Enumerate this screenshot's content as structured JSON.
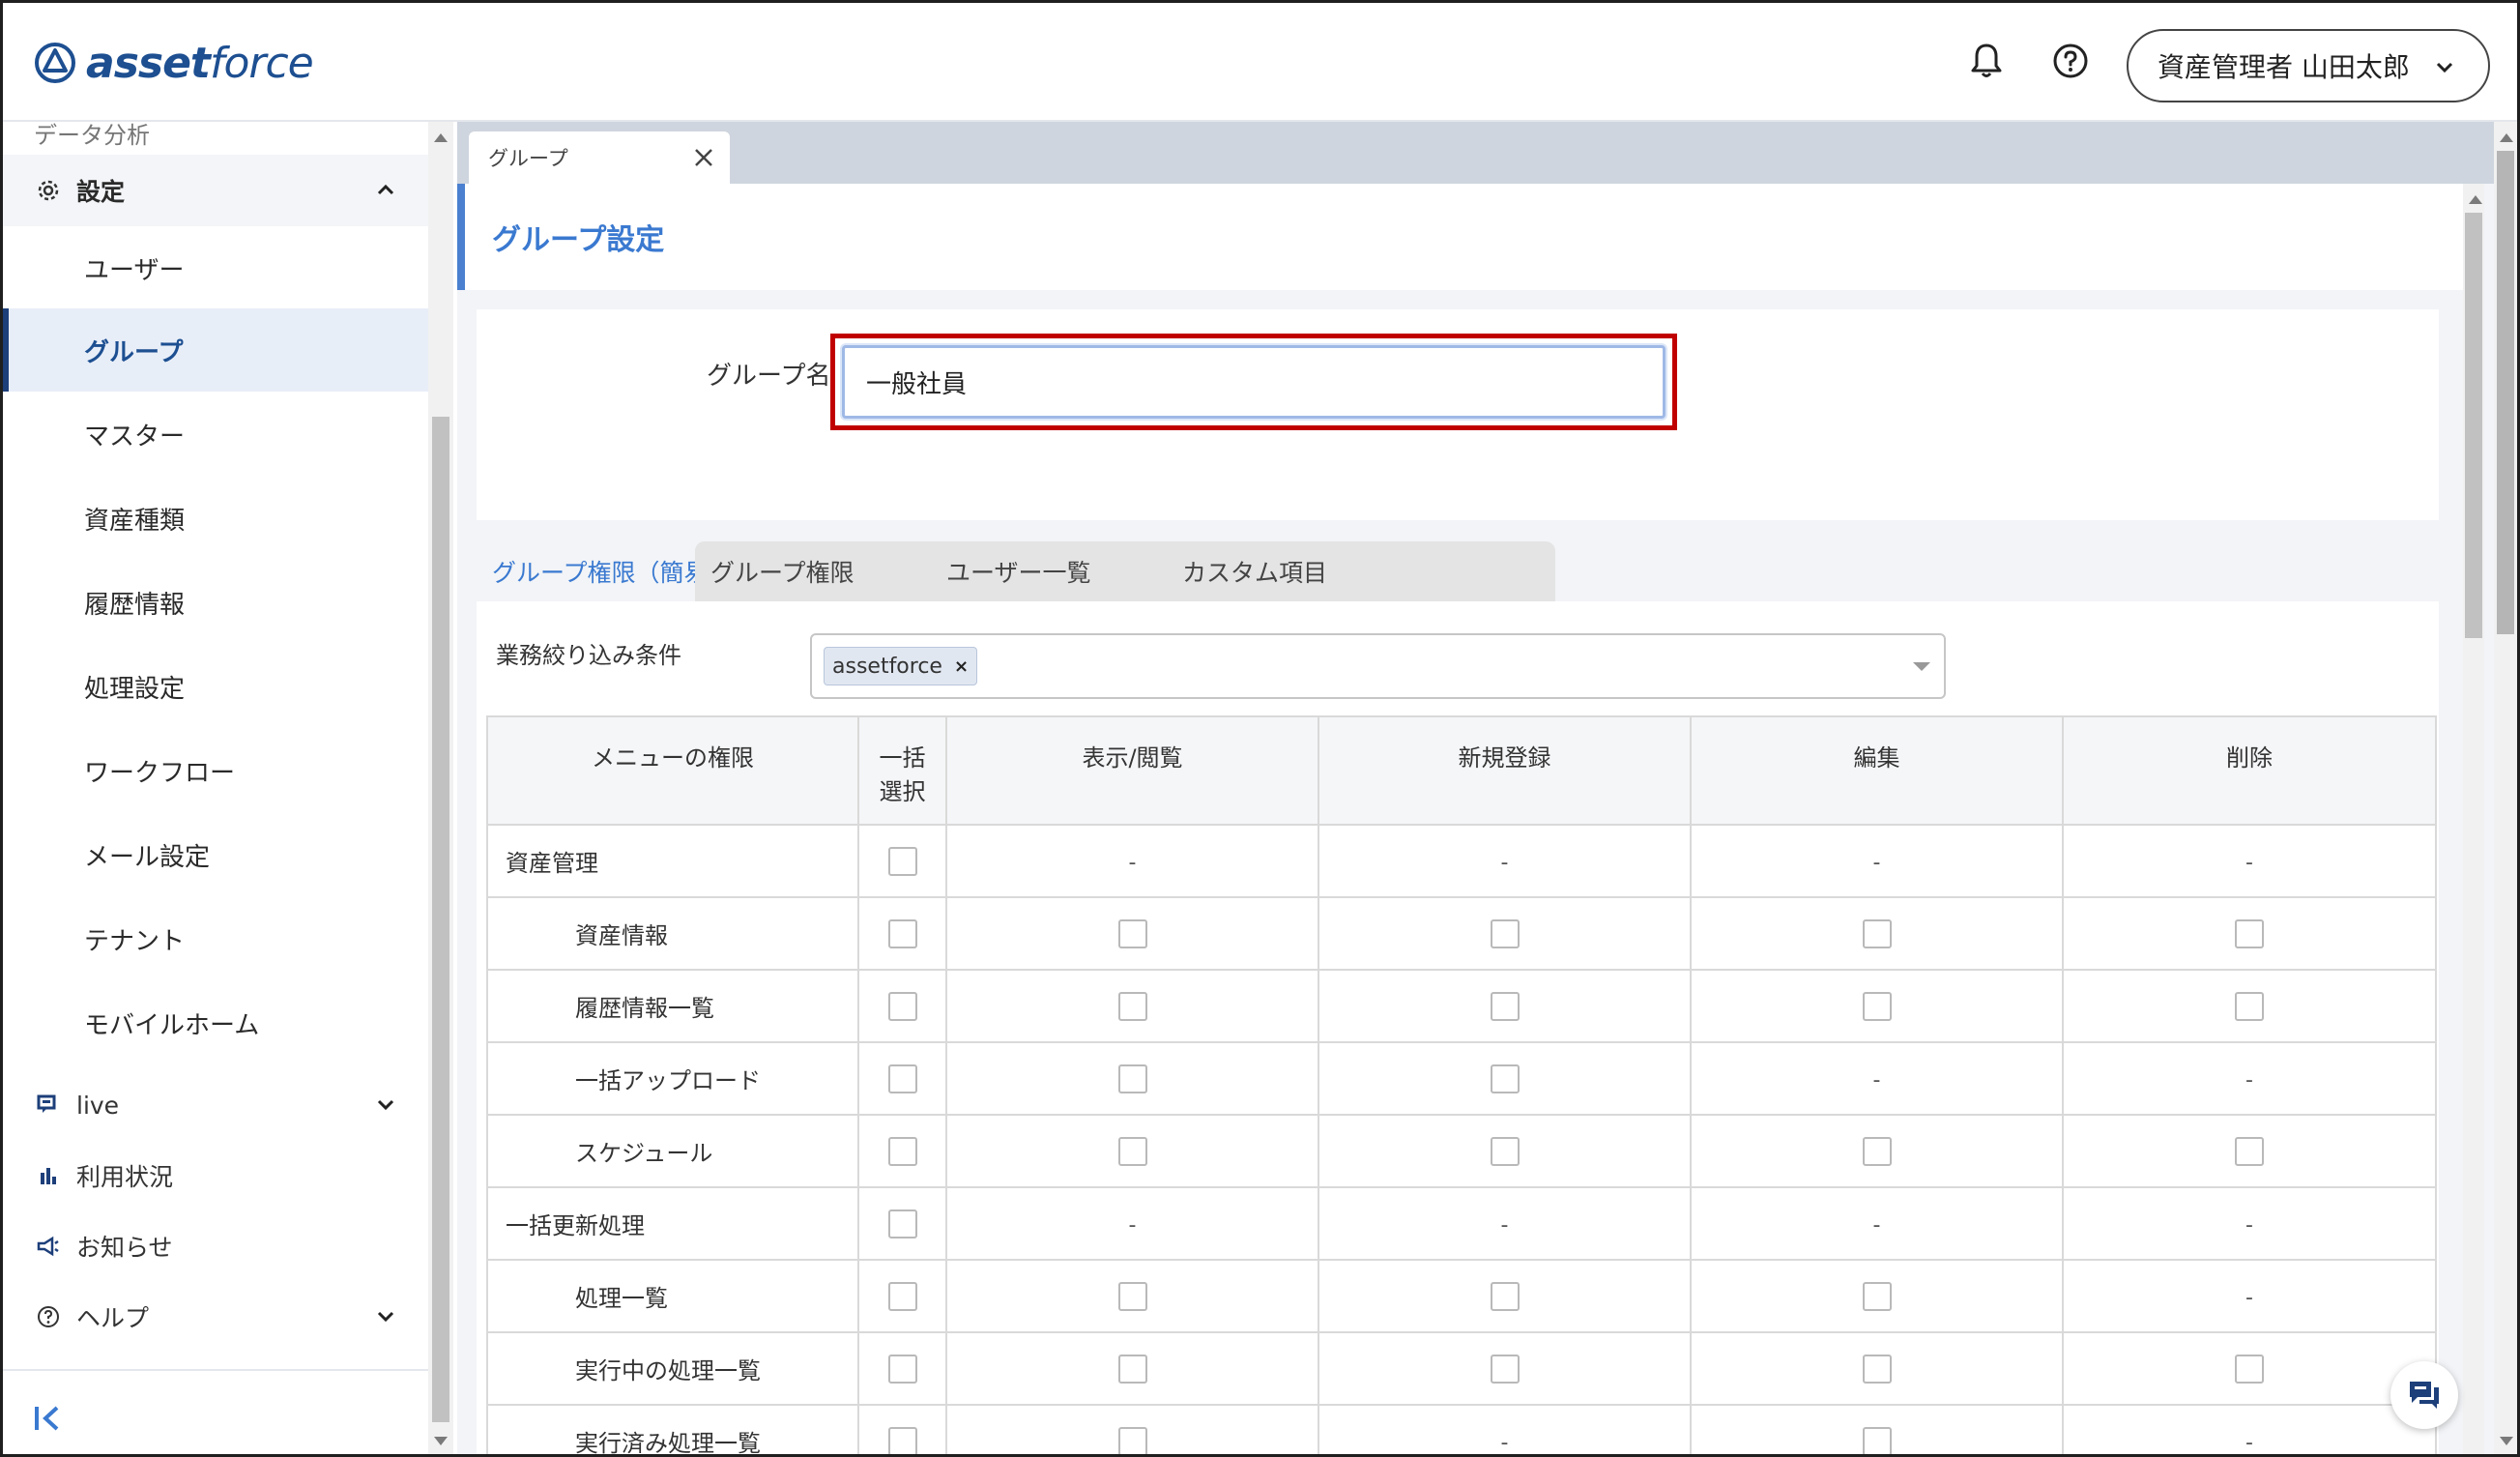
{
  "app": {
    "logo_text_bold": "asset",
    "logo_text_light": "force",
    "user_label": "資産管理者 山田太郎"
  },
  "sidebar": {
    "partial_item": "データ分析",
    "settings_label": "設定",
    "sub_items": [
      {
        "label": "ユーザー",
        "active": false
      },
      {
        "label": "グループ",
        "active": true
      },
      {
        "label": "マスター",
        "active": false
      },
      {
        "label": "資産種類",
        "active": false
      },
      {
        "label": "履歴情報",
        "active": false
      },
      {
        "label": "処理設定",
        "active": false
      },
      {
        "label": "ワークフロー",
        "active": false
      },
      {
        "label": "メール設定",
        "active": false
      },
      {
        "label": "テナント",
        "active": false
      },
      {
        "label": "モバイルホーム",
        "active": false
      }
    ],
    "sections": [
      {
        "label": "live",
        "icon": "live-chat-icon"
      },
      {
        "label": "利用状況",
        "icon": "bar-chart-icon"
      },
      {
        "label": "お知らせ",
        "icon": "megaphone-icon"
      },
      {
        "label": "ヘルプ",
        "icon": "help-circle-icon"
      }
    ]
  },
  "main": {
    "doc_tab_label": "グループ",
    "page_title": "グループ設定",
    "form": {
      "group_name_label": "グループ名",
      "group_name_value": "一般社員"
    },
    "tabs": [
      {
        "label": "グループ権限（簡易版）",
        "active": true
      },
      {
        "label": "グループ権限",
        "active": false
      },
      {
        "label": "ユーザー一覧",
        "active": false
      },
      {
        "label": "カスタム項目",
        "active": false
      }
    ],
    "filter": {
      "label": "業務絞り込み条件",
      "chip": "assetforce",
      "chip_remove": "×"
    },
    "table": {
      "headers": [
        "メニューの権限",
        "一括\n選択",
        "表示/閲覧",
        "新規登録",
        "編集",
        "削除"
      ],
      "rows": [
        {
          "name": "資産管理",
          "child": false,
          "cells": [
            "cb",
            "-",
            "-",
            "-",
            "-"
          ]
        },
        {
          "name": "資産情報",
          "child": true,
          "cells": [
            "cb",
            "cb",
            "cb",
            "cb",
            "cb"
          ]
        },
        {
          "name": "履歴情報一覧",
          "child": true,
          "cells": [
            "cb",
            "cb",
            "cb",
            "cb",
            "cb"
          ]
        },
        {
          "name": "一括アップロード",
          "child": true,
          "cells": [
            "cb",
            "cb",
            "cb",
            "-",
            "-"
          ]
        },
        {
          "name": "スケジュール",
          "child": true,
          "cells": [
            "cb",
            "cb",
            "cb",
            "cb",
            "cb"
          ]
        },
        {
          "name": "一括更新処理",
          "child": false,
          "cells": [
            "cb",
            "-",
            "-",
            "-",
            "-"
          ]
        },
        {
          "name": "処理一覧",
          "child": true,
          "cells": [
            "cb",
            "cb",
            "cb",
            "cb",
            "-"
          ]
        },
        {
          "name": "実行中の処理一覧",
          "child": true,
          "cells": [
            "cb",
            "cb",
            "cb",
            "cb",
            "cb"
          ]
        },
        {
          "name": "実行済み処理一覧",
          "child": true,
          "cells": [
            "cb",
            "cb",
            "-",
            "cb",
            "-"
          ]
        }
      ]
    }
  },
  "colors": {
    "brand": "#1d4f91",
    "accent": "#3a79d0",
    "highlight": "#c00000"
  }
}
